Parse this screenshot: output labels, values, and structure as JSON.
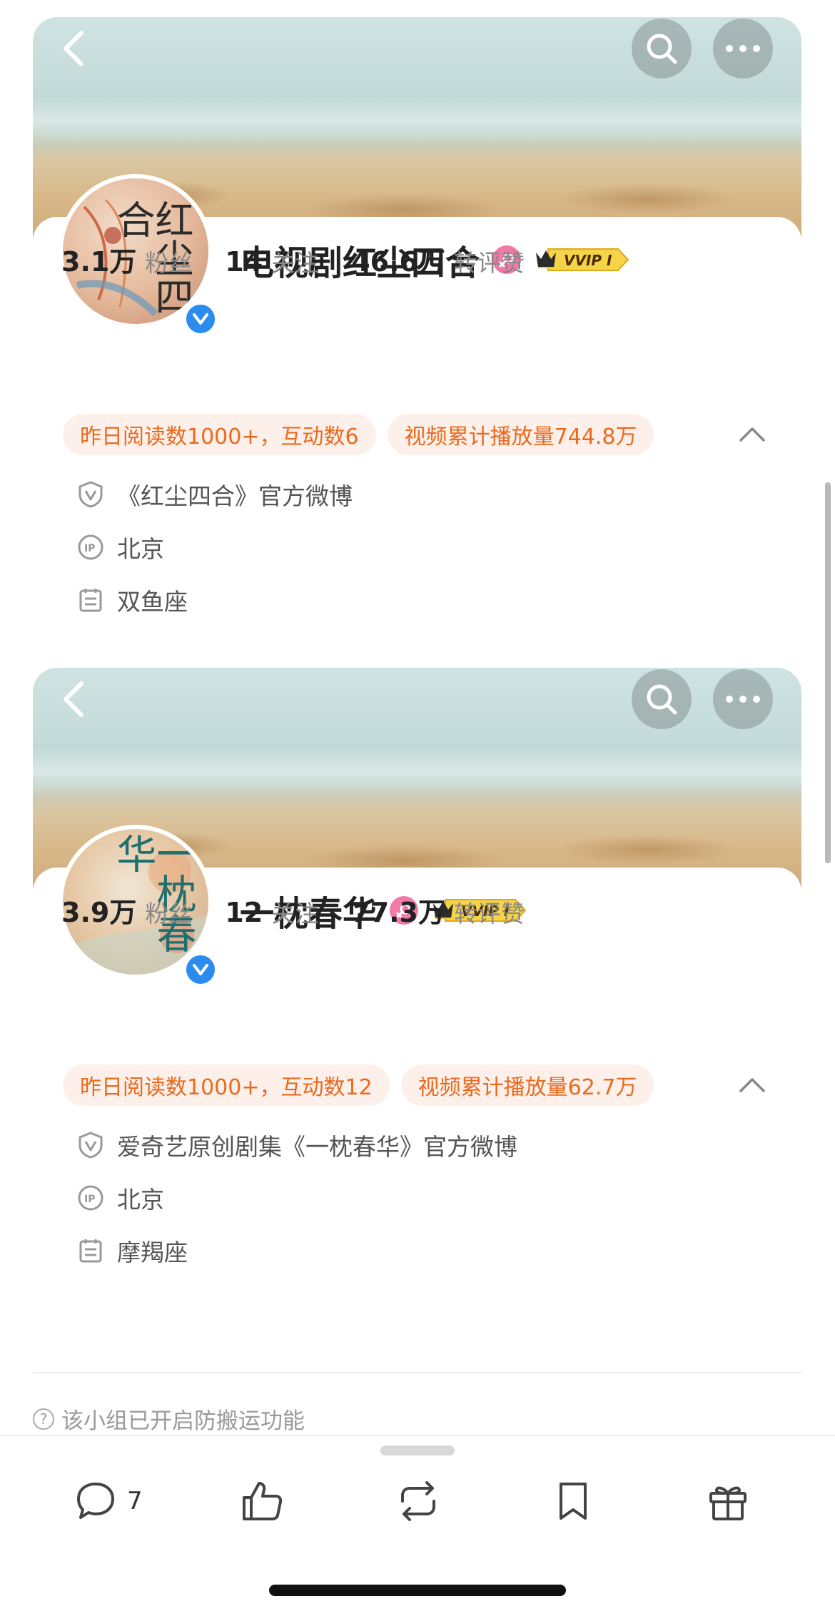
{
  "profiles": [
    {
      "avatar_text": "红尘四合",
      "name": "电视剧红尘四合",
      "vip_label": "VVIP I",
      "stats": [
        {
          "num": "3.1万",
          "label": "粉丝"
        },
        {
          "num": "14",
          "label": "关注"
        },
        {
          "num": "46.6万",
          "label": "转评赞"
        }
      ],
      "tags": [
        "昨日阅读数1000+，互动数6",
        "视频累计播放量744.8万"
      ],
      "info": [
        {
          "icon": "verified-shield-icon",
          "text": "《红尘四合》官方微博"
        },
        {
          "icon": "ip-location-icon",
          "text": "北京"
        },
        {
          "icon": "calendar-icon",
          "text": "双鱼座"
        }
      ]
    },
    {
      "avatar_text": "一枕春华",
      "name": "一枕春华",
      "vip_label": "VVIP I",
      "stats": [
        {
          "num": "3.9万",
          "label": "粉丝"
        },
        {
          "num": "12",
          "label": "关注"
        },
        {
          "num": "77.3万",
          "label": "转评赞"
        }
      ],
      "tags": [
        "昨日阅读数1000+，互动数12",
        "视频累计播放量62.7万"
      ],
      "info": [
        {
          "icon": "verified-shield-icon",
          "text": "爱奇艺原创剧集《一枕春华》官方微博"
        },
        {
          "icon": "ip-location-icon",
          "text": "北京"
        },
        {
          "icon": "calendar-icon",
          "text": "摩羯座"
        }
      ]
    }
  ],
  "notice": "该小组已开启防搬运功能",
  "action_bar": {
    "comment_count": "7",
    "icons": [
      "comment-icon",
      "like-icon",
      "repost-icon",
      "bookmark-icon",
      "gift-icon"
    ]
  },
  "colors": {
    "tag_text": "#ea6a1e",
    "tag_bg": "#fdf0ea",
    "verify_blue": "#2b8cf0",
    "female_pink": "#f07aa6",
    "vvip_gold": "#f3c435"
  }
}
